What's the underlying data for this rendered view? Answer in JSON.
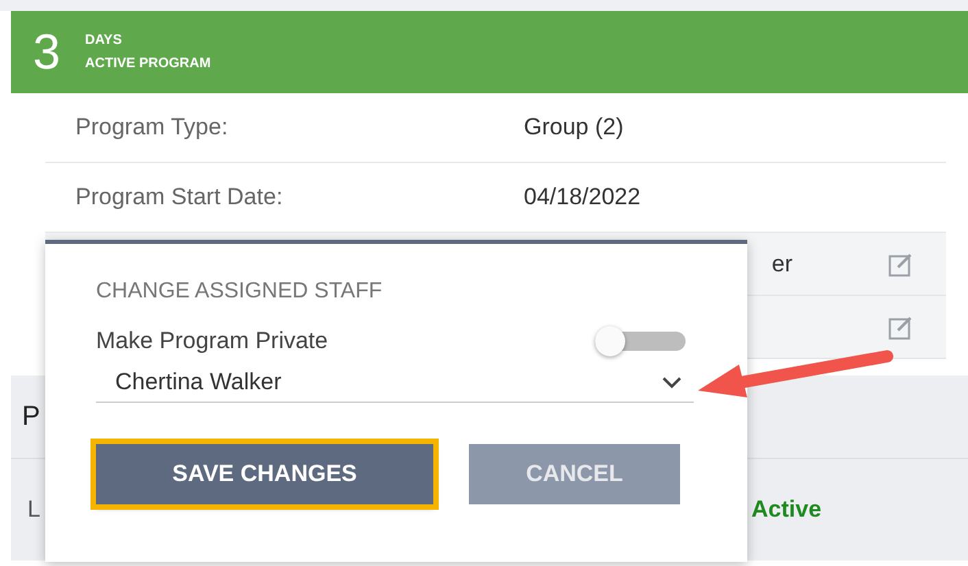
{
  "banner": {
    "count": "3",
    "unit": "DAYS",
    "caption": "ACTIVE PROGRAM"
  },
  "details": [
    {
      "label": "Program Type:",
      "value": "Group (2)"
    },
    {
      "label": "Program Start Date:",
      "value": "04/18/2022"
    }
  ],
  "hidden_rows": [
    {
      "value": "er"
    },
    {
      "value": ""
    }
  ],
  "section": {
    "heading": "P",
    "row_label": "L",
    "status": "Active"
  },
  "dialog": {
    "title": "CHANGE ASSIGNED STAFF",
    "toggle": {
      "label": "Make Program Private",
      "on": false
    },
    "staff_select": {
      "value": "Chertina Walker"
    },
    "buttons": [
      {
        "label": "SAVE CHANGES",
        "kind": "primary",
        "highlighted": true
      },
      {
        "label": "CANCEL",
        "kind": "secondary",
        "highlighted": false
      }
    ]
  }
}
